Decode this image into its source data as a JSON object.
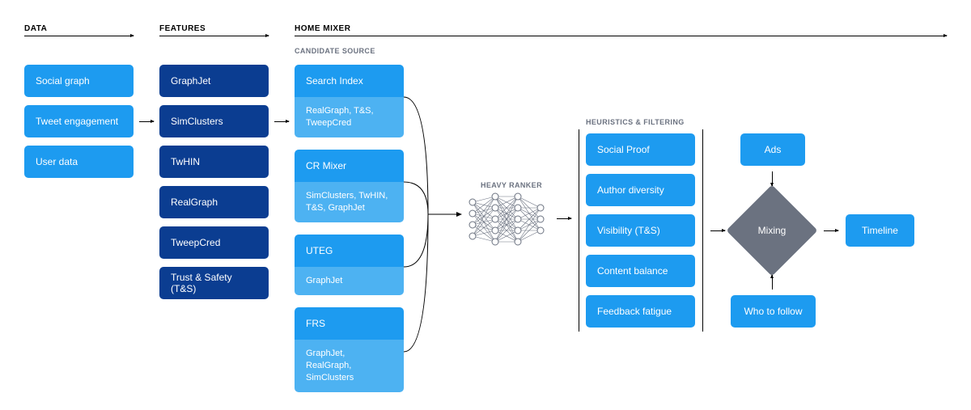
{
  "sections": {
    "data": "DATA",
    "features": "FEATURES",
    "home_mixer": "HOME MIXER",
    "candidate_source": "CANDIDATE SOURCE",
    "heavy_ranker": "HEAVY RANKER",
    "heuristics": "HEURISTICS & FILTERING"
  },
  "data_col": [
    "Social graph",
    "Tweet engagement",
    "User data"
  ],
  "features_col": [
    "GraphJet",
    "SimClusters",
    "TwHIN",
    "RealGraph",
    "TweepCred",
    "Trust & Safety (T&S)"
  ],
  "candidate_sources": [
    {
      "name": "Search Index",
      "sub": "RealGraph, T&S, TweepCred"
    },
    {
      "name": "CR Mixer",
      "sub": "SimClusters, TwHIN, T&S, GraphJet"
    },
    {
      "name": "UTEG",
      "sub": "GraphJet"
    },
    {
      "name": "FRS",
      "sub": "GraphJet, RealGraph, SimClusters"
    }
  ],
  "heuristics": [
    "Social Proof",
    "Author diversity",
    "Visibility (T&S)",
    "Content balance",
    "Feedback fatigue"
  ],
  "mixing_inputs": {
    "top": "Ads",
    "bottom": "Who to follow"
  },
  "mixing": "Mixing",
  "output": "Timeline"
}
